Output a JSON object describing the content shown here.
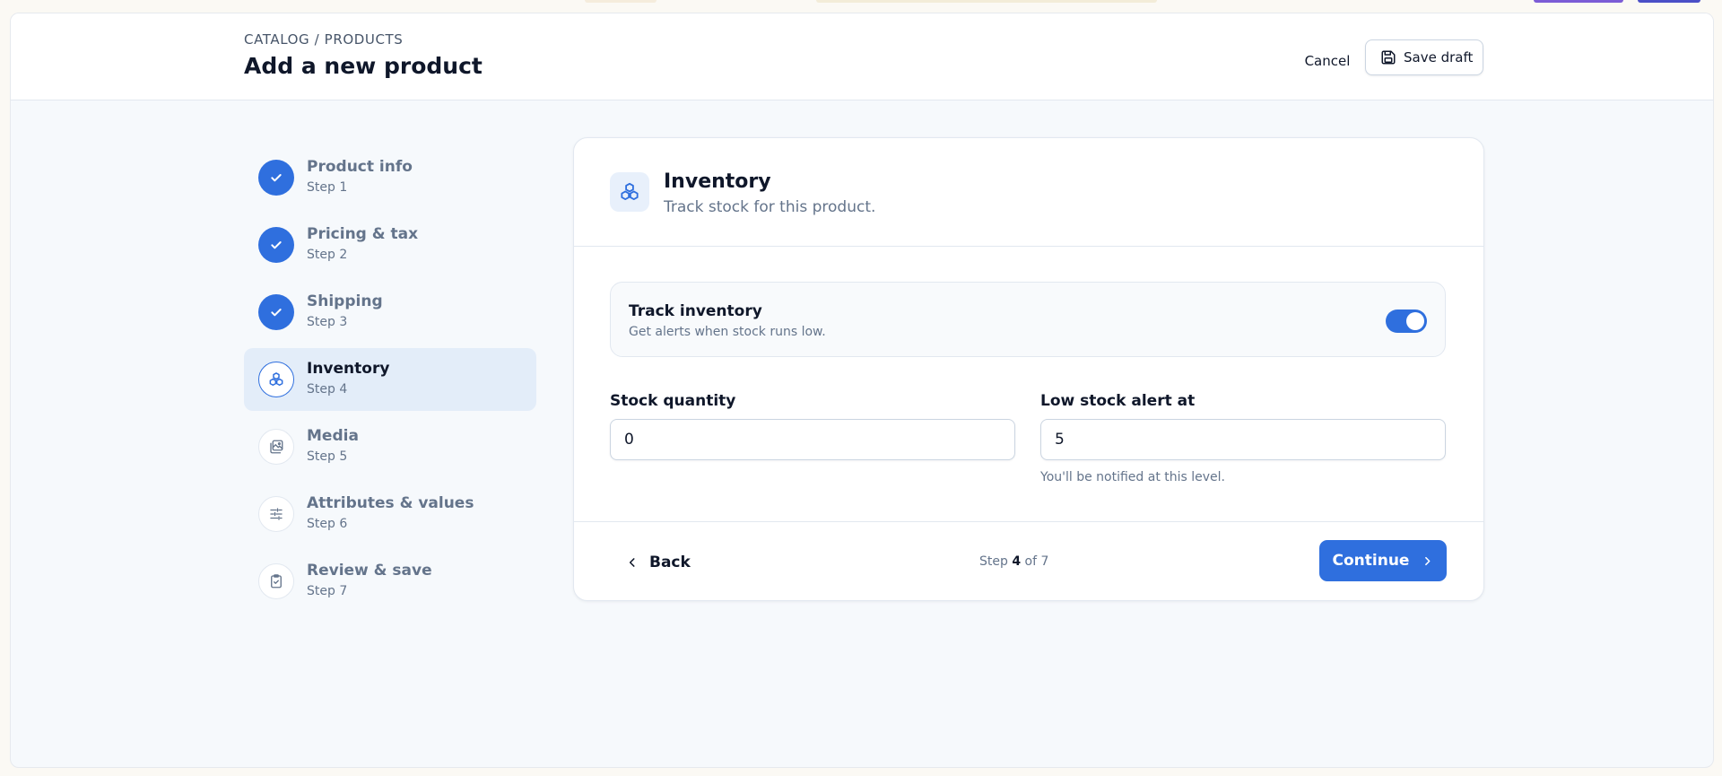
{
  "header": {
    "breadcrumb": "CATALOG / PRODUCTS",
    "title": "Add a new product",
    "cancel_label": "Cancel",
    "save_label": "Save draft"
  },
  "steps": [
    {
      "label": "Product info",
      "sub": "Step 1",
      "status": "done",
      "icon": "check-icon"
    },
    {
      "label": "Pricing & tax",
      "sub": "Step 2",
      "status": "done",
      "icon": "check-icon"
    },
    {
      "label": "Shipping",
      "sub": "Step 3",
      "status": "done",
      "icon": "check-icon"
    },
    {
      "label": "Inventory",
      "sub": "Step 4",
      "status": "current",
      "icon": "boxes-icon"
    },
    {
      "label": "Media",
      "sub": "Step 5",
      "status": "todo",
      "icon": "image-icon"
    },
    {
      "label": "Attributes & values",
      "sub": "Step 6",
      "status": "todo",
      "icon": "sliders-icon"
    },
    {
      "label": "Review & save",
      "sub": "Step 7",
      "status": "todo",
      "icon": "clipboard-check-icon"
    }
  ],
  "card": {
    "title": "Inventory",
    "subtitle": "Track stock for this product.",
    "icon": "boxes-icon",
    "track": {
      "title": "Track inventory",
      "subtitle": "Get alerts when stock runs low.",
      "enabled": true
    },
    "stock": {
      "label": "Stock quantity",
      "value": "0"
    },
    "low_stock": {
      "label": "Low stock alert at",
      "value": "5",
      "help": "You'll be notified at this level."
    },
    "footer": {
      "back_label": "Back",
      "step_prefix": "Step",
      "step_current": "4",
      "step_suffix": "of 7",
      "continue_label": "Continue"
    }
  },
  "colors": {
    "accent": "#2f6fde",
    "page_bg": "#f6f9fc",
    "active_step_bg": "#e3edf9"
  }
}
